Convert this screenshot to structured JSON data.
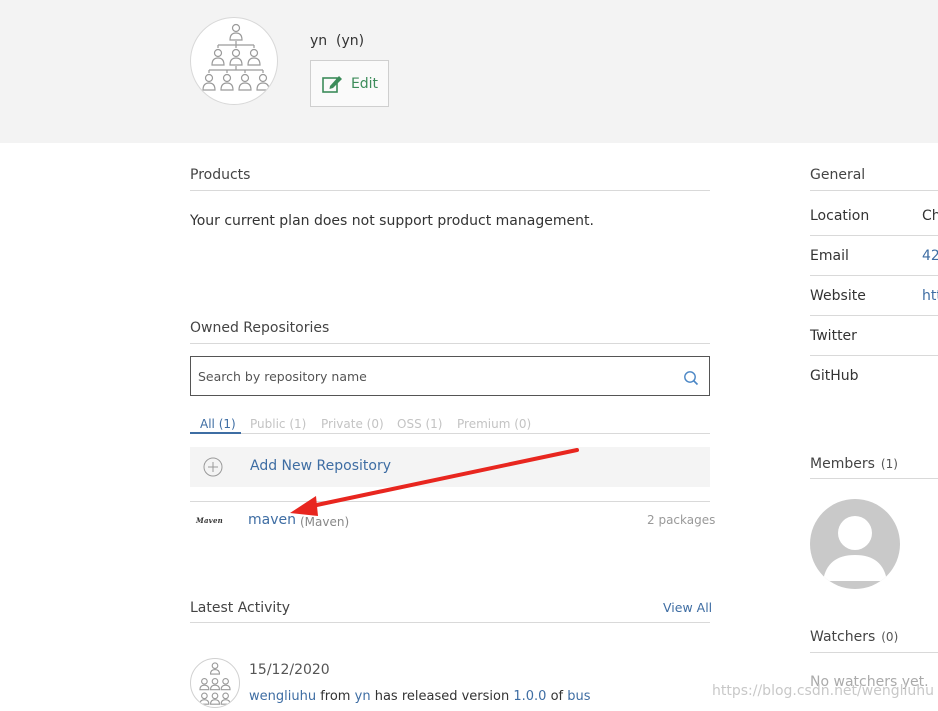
{
  "header": {
    "org_name": "yn  (yn)",
    "edit_label": "Edit"
  },
  "products": {
    "title": "Products",
    "message": "Your current plan does not support product management."
  },
  "repositories": {
    "title": "Owned Repositories",
    "search_placeholder": "Search by repository name",
    "tabs": [
      {
        "label": "All (1)",
        "active": true
      },
      {
        "label": "Public (1)",
        "active": false
      },
      {
        "label": "Private (0)",
        "active": false
      },
      {
        "label": "OSS (1)",
        "active": false
      },
      {
        "label": "Premium (0)",
        "active": false
      }
    ],
    "add_label": "Add New Repository",
    "items": [
      {
        "logo_text": "Maven",
        "name": "maven",
        "type": "(Maven)",
        "count": "2 packages"
      }
    ]
  },
  "activity": {
    "title": "Latest Activity",
    "view_all": "View All",
    "items": [
      {
        "date": "15/12/2020",
        "user": "wengliuhu",
        "from_word": "from",
        "org": "yn",
        "text1": "has released version",
        "version": "1.0.0",
        "of_word": "of",
        "package": "bus"
      }
    ]
  },
  "sidebar": {
    "general_title": "General",
    "fields": [
      {
        "label": "Location",
        "value": "Ch",
        "link": false
      },
      {
        "label": "Email",
        "value": "42",
        "link": true
      },
      {
        "label": "Website",
        "value": "htt",
        "link": true
      },
      {
        "label": "Twitter",
        "value": "",
        "link": false
      },
      {
        "label": "GitHub",
        "value": "",
        "link": false
      }
    ],
    "members_title": "Members",
    "members_count": "(1)",
    "watchers_title": "Watchers",
    "watchers_count": "(0)",
    "no_watchers": "No watchers yet."
  },
  "watermark": "https://blog.csdn.net/wengliuhu",
  "colors": {
    "link": "#3e6da3",
    "edit_green": "#3c8c5a",
    "annotation_arrow": "#e8261f",
    "header_bg": "#f3f3f3"
  },
  "icons": [
    "org-hierarchy-icon",
    "edit-icon",
    "search-icon",
    "add-circle-icon",
    "maven-logo",
    "user-placeholder-icon"
  ]
}
